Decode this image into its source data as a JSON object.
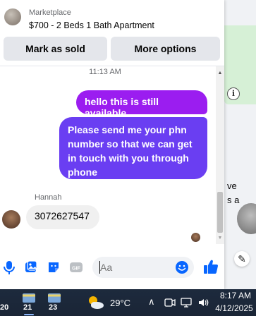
{
  "header": {
    "subtitle": "Marketplace",
    "title": "$700 - 2 Beds 1 Bath Apartment",
    "mark_sold_label": "Mark as sold",
    "more_options_label": "More options"
  },
  "background_page": {
    "text_line_1": "ve",
    "text_line_2": "s a",
    "info_icon": "info-icon",
    "edit_icon": "edit-icon"
  },
  "messages": {
    "timestamp": "11:13 AM",
    "outgoing": [
      "hello this is still available",
      "Please send me your phn number so that we can get in touch with you through phone"
    ],
    "sender_name": "Hannah",
    "incoming": [
      "3072627547"
    ]
  },
  "composer": {
    "placeholder": "Aa",
    "icons": [
      "microphone-icon",
      "photo-icon",
      "sticker-icon",
      "gif-icon",
      "emoji-icon",
      "thumbs-up-icon"
    ],
    "gif_label": "GIF"
  },
  "taskbar": {
    "app_badges": [
      "20",
      "21",
      "23"
    ],
    "temperature": "29°C",
    "tray_icons": [
      "chevron-up-icon",
      "meet-now-icon",
      "network-icon",
      "volume-icon"
    ],
    "time": "8:17 AM",
    "date": "4/12/2025"
  },
  "colors": {
    "accent_purple": "#9b1df0",
    "accent_blue": "#6a3ef2",
    "facebook_blue": "#0866ff"
  }
}
